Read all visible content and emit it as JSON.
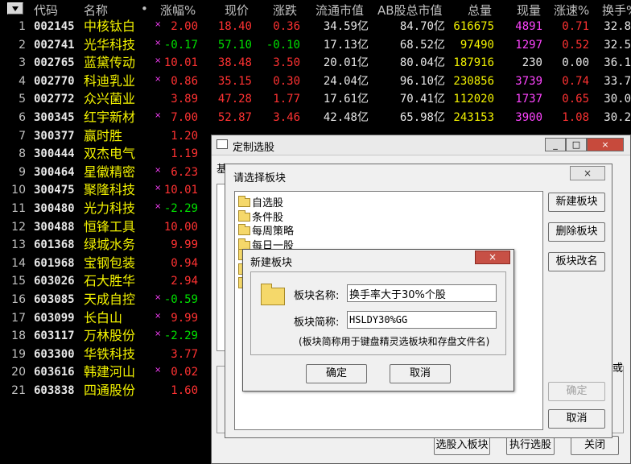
{
  "header": {
    "columns": [
      "代码",
      "名称",
      "•",
      "涨幅%",
      "现价",
      "涨跌",
      "流通市值",
      "AB股总市值",
      "总量",
      "现量",
      "涨速%",
      "换手%"
    ]
  },
  "rows": [
    {
      "idx": "1",
      "code": "002145",
      "name": "中核钛白",
      "mark": "×",
      "chg_pct": "2.00",
      "price": "18.40",
      "chg": "0.36",
      "float_cap": "34.59亿",
      "total_cap": "84.70亿",
      "vol": "616675",
      "cur": "4891",
      "speed": "0.71",
      "turn": "32.8"
    },
    {
      "idx": "2",
      "code": "002741",
      "name": "光华科技",
      "mark": "×",
      "chg_pct": "-0.17",
      "price": "57.10",
      "chg": "-0.10",
      "float_cap": "17.13亿",
      "total_cap": "68.52亿",
      "vol": "97490",
      "cur": "1297",
      "speed": "0.52",
      "turn": "32.5"
    },
    {
      "idx": "3",
      "code": "002765",
      "name": "蓝黛传动",
      "mark": "×",
      "chg_pct": "10.01",
      "price": "38.48",
      "chg": "3.50",
      "float_cap": "20.01亿",
      "total_cap": "80.04亿",
      "vol": "187916",
      "cur": "230",
      "speed": "0.00",
      "turn": "36.1"
    },
    {
      "idx": "4",
      "code": "002770",
      "name": "科迪乳业",
      "mark": "×",
      "chg_pct": "0.86",
      "price": "35.15",
      "chg": "0.30",
      "float_cap": "24.04亿",
      "total_cap": "96.10亿",
      "vol": "230856",
      "cur": "3739",
      "speed": "0.74",
      "turn": "33.7"
    },
    {
      "idx": "5",
      "code": "002772",
      "name": "众兴菌业",
      "mark": "",
      "chg_pct": "3.89",
      "price": "47.28",
      "chg": "1.77",
      "float_cap": "17.61亿",
      "total_cap": "70.41亿",
      "vol": "112020",
      "cur": "1737",
      "speed": "0.65",
      "turn": "30.0"
    },
    {
      "idx": "6",
      "code": "300345",
      "name": "红宇新材",
      "mark": "×",
      "chg_pct": "7.00",
      "price": "52.87",
      "chg": "3.46",
      "float_cap": "42.48亿",
      "total_cap": "65.98亿",
      "vol": "243153",
      "cur": "3900",
      "speed": "1.08",
      "turn": "30.2"
    },
    {
      "idx": "7",
      "code": "300377",
      "name": "赢时胜",
      "mark": "",
      "chg_pct": "1.20",
      "price": "",
      "chg": "",
      "float_cap": "",
      "total_cap": "",
      "vol": "",
      "cur": "",
      "speed": "",
      "turn": ""
    },
    {
      "idx": "8",
      "code": "300444",
      "name": "双杰电气",
      "mark": "",
      "chg_pct": "1.19",
      "price": "",
      "chg": "",
      "float_cap": "",
      "total_cap": "",
      "vol": "",
      "cur": "",
      "speed": "",
      "turn": ""
    },
    {
      "idx": "9",
      "code": "300464",
      "name": "星徽精密",
      "mark": "×",
      "chg_pct": "6.23",
      "price": "",
      "chg": "",
      "float_cap": "",
      "total_cap": "",
      "vol": "",
      "cur": "",
      "speed": "",
      "turn": ""
    },
    {
      "idx": "10",
      "code": "300475",
      "name": "聚隆科技",
      "mark": "×",
      "chg_pct": "10.01",
      "price": "",
      "chg": "",
      "float_cap": "",
      "total_cap": "",
      "vol": "",
      "cur": "",
      "speed": "",
      "turn": ""
    },
    {
      "idx": "11",
      "code": "300480",
      "name": "光力科技",
      "mark": "×",
      "chg_pct": "-2.29",
      "price": "",
      "chg": "",
      "float_cap": "",
      "total_cap": "",
      "vol": "",
      "cur": "",
      "speed": "",
      "turn": ""
    },
    {
      "idx": "12",
      "code": "300488",
      "name": "恒锋工具",
      "mark": "",
      "chg_pct": "10.00",
      "price": "",
      "chg": "",
      "float_cap": "",
      "total_cap": "",
      "vol": "",
      "cur": "",
      "speed": "",
      "turn": ""
    },
    {
      "idx": "13",
      "code": "601368",
      "name": "绿城水务",
      "mark": "",
      "chg_pct": "9.99",
      "price": "",
      "chg": "",
      "float_cap": "",
      "total_cap": "",
      "vol": "",
      "cur": "",
      "speed": "",
      "turn": ""
    },
    {
      "idx": "14",
      "code": "601968",
      "name": "宝钢包装",
      "mark": "",
      "chg_pct": "0.94",
      "price": "",
      "chg": "",
      "float_cap": "",
      "total_cap": "",
      "vol": "",
      "cur": "",
      "speed": "",
      "turn": ""
    },
    {
      "idx": "15",
      "code": "603026",
      "name": "石大胜华",
      "mark": "",
      "chg_pct": "2.94",
      "price": "",
      "chg": "",
      "float_cap": "",
      "total_cap": "",
      "vol": "",
      "cur": "",
      "speed": "",
      "turn": ""
    },
    {
      "idx": "16",
      "code": "603085",
      "name": "天成自控",
      "mark": "×",
      "chg_pct": "-0.59",
      "price": "",
      "chg": "",
      "float_cap": "",
      "total_cap": "",
      "vol": "",
      "cur": "",
      "speed": "",
      "turn": ""
    },
    {
      "idx": "17",
      "code": "603099",
      "name": "长白山",
      "mark": "×",
      "chg_pct": "9.99",
      "price": "",
      "chg": "",
      "float_cap": "",
      "total_cap": "",
      "vol": "",
      "cur": "",
      "speed": "",
      "turn": ""
    },
    {
      "idx": "18",
      "code": "603117",
      "name": "万林股份",
      "mark": "×",
      "chg_pct": "-2.29",
      "price": "",
      "chg": "",
      "float_cap": "",
      "total_cap": "",
      "vol": "",
      "cur": "",
      "speed": "",
      "turn": ""
    },
    {
      "idx": "19",
      "code": "603300",
      "name": "华铁科技",
      "mark": "",
      "chg_pct": "3.77",
      "price": "",
      "chg": "",
      "float_cap": "",
      "total_cap": "",
      "vol": "",
      "cur": "",
      "speed": "",
      "turn": ""
    },
    {
      "idx": "20",
      "code": "603616",
      "name": "韩建河山",
      "mark": "×",
      "chg_pct": "0.02",
      "price": "",
      "chg": "",
      "float_cap": "",
      "total_cap": "",
      "vol": "",
      "cur": "",
      "speed": "",
      "turn": ""
    },
    {
      "idx": "21",
      "code": "603838",
      "name": "四通股份",
      "mark": "",
      "chg_pct": "1.60",
      "price": "",
      "chg": "",
      "float_cap": "",
      "total_cap": "",
      "vol": "",
      "cur": "",
      "speed": "",
      "turn": ""
    }
  ],
  "custom_dialog": {
    "title": "定制选股",
    "tab_first_char": "基",
    "right_partial_text": "或",
    "buttons": {
      "add_to_block": "选股入板块",
      "execute": "执行选股",
      "close": "关闭"
    }
  },
  "choose_block": {
    "title": "请选择板块",
    "list": [
      "自选股",
      "条件股",
      "每周策略",
      "每日一股",
      "",
      "",
      ""
    ],
    "buttons": {
      "new_block": "新建板块",
      "delete_block": "删除板块",
      "rename_block": "板块改名",
      "ok": "确定",
      "cancel": "取消"
    }
  },
  "new_block": {
    "title": "新建板块",
    "name_label": "板块名称:",
    "name_value": "换手率大于30%个股",
    "abbr_label": "板块简称:",
    "abbr_value": "HSLDY30%GG",
    "hint": "(板块简称用于键盘精灵选板块和存盘文件名)",
    "ok": "确定",
    "cancel": "取消",
    "close_glyph": "×"
  }
}
